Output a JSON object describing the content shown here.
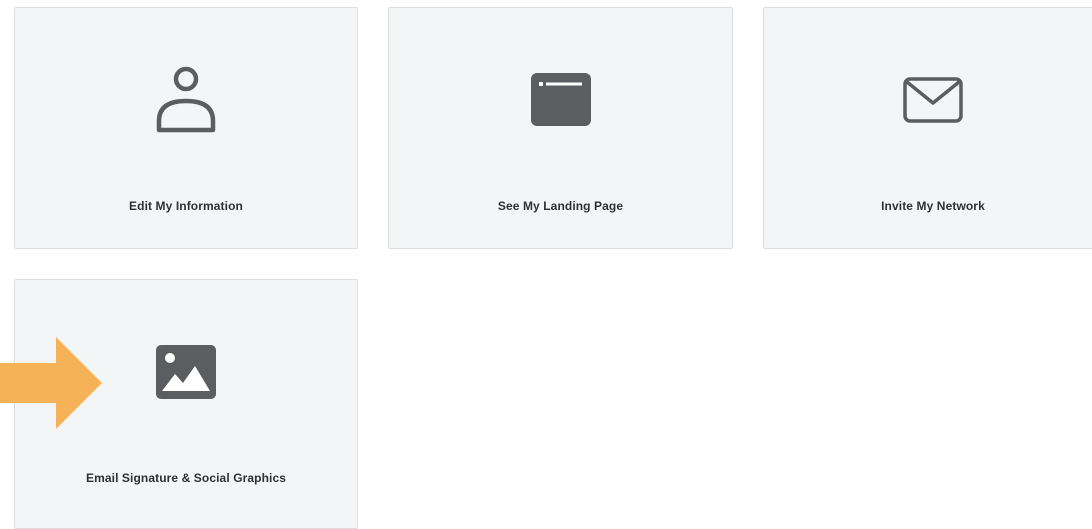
{
  "cards": [
    {
      "label": "Edit My Information",
      "icon": "user-icon"
    },
    {
      "label": "See My Landing Page",
      "icon": "browser-window-icon"
    },
    {
      "label": "Invite My Network",
      "icon": "envelope-icon"
    },
    {
      "label": "Email Signature & Social Graphics",
      "icon": "image-icon"
    }
  ],
  "colors": {
    "card_background": "#f4f5f7",
    "card_border": "#dcdde0",
    "icon": "#5b5d60",
    "label_text": "#2f3133",
    "arrow": "#f6b257"
  }
}
